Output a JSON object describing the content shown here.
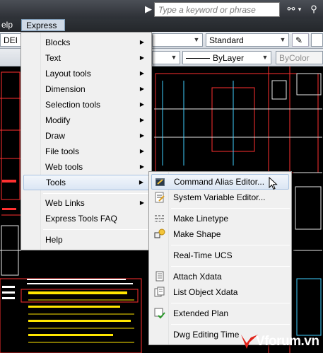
{
  "search": {
    "placeholder": "Type a keyword or phrase"
  },
  "menubar": {
    "items": [
      "elp",
      "Express"
    ]
  },
  "toolbar1": {
    "left_combo": "DEI",
    "style_combo": "Standard"
  },
  "toolbar2": {
    "linetype_combo": "ByLayer",
    "lineweight_combo": "ByColor"
  },
  "express_menu": {
    "items": [
      {
        "label": "Blocks",
        "submenu": true
      },
      {
        "label": "Text",
        "submenu": true
      },
      {
        "label": "Layout tools",
        "submenu": true
      },
      {
        "label": "Dimension",
        "submenu": true
      },
      {
        "label": "Selection tools",
        "submenu": true
      },
      {
        "label": "Modify",
        "submenu": true
      },
      {
        "label": "Draw",
        "submenu": true
      },
      {
        "label": "File tools",
        "submenu": true
      },
      {
        "label": "Web tools",
        "submenu": true
      },
      {
        "label": "Tools",
        "submenu": true,
        "highlighted": true
      },
      {
        "label": "Web Links",
        "submenu": true
      },
      {
        "label": "Express Tools FAQ",
        "submenu": false
      },
      {
        "label": "Help",
        "submenu": false
      }
    ]
  },
  "tools_submenu": {
    "items": [
      {
        "label": "Command Alias Editor...",
        "icon": "alias-editor-icon",
        "highlighted": true
      },
      {
        "label": "System Variable Editor...",
        "icon": "sysvar-editor-icon"
      },
      {
        "label": "Make Linetype",
        "icon": "make-linetype-icon"
      },
      {
        "label": "Make Shape",
        "icon": "make-shape-icon"
      },
      {
        "label": "Real-Time UCS",
        "icon": ""
      },
      {
        "label": "Attach Xdata",
        "icon": "attach-xdata-icon"
      },
      {
        "label": "List Object Xdata",
        "icon": "list-xdata-icon"
      },
      {
        "label": "Extended Plan",
        "icon": "extended-plan-icon"
      },
      {
        "label": "Dwg Editing Time",
        "icon": ""
      }
    ]
  },
  "watermark": {
    "text": "Vforum.vn"
  },
  "colors": {
    "canvas": "#000000",
    "highlight": "#dbe6f4",
    "menu_bg": "#f0f0f0"
  }
}
